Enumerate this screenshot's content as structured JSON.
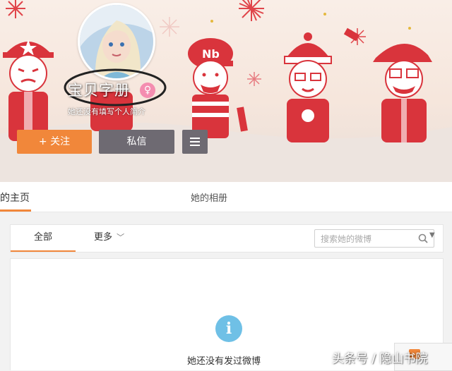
{
  "profile": {
    "name": "宝贝字册",
    "intro": "她还没有填写个人简介",
    "gender_icon": "female-icon"
  },
  "actions": {
    "follow_label": "+ 关注",
    "message_label": "私信",
    "menu_icon": "menu-icon"
  },
  "tabs": {
    "home_label": "的主页",
    "album_label": "她的相册"
  },
  "feed": {
    "filter_all": "全部",
    "filter_more": "更多",
    "search_placeholder": "搜索她的微博",
    "empty_message": "她还没有发过微博"
  },
  "watermark": "头条号 / 隐山书院",
  "colors": {
    "accent": "#f1873a",
    "button_dark": "#6e6a72",
    "info": "#6fc0e6",
    "banner_red": "#d9343c"
  }
}
